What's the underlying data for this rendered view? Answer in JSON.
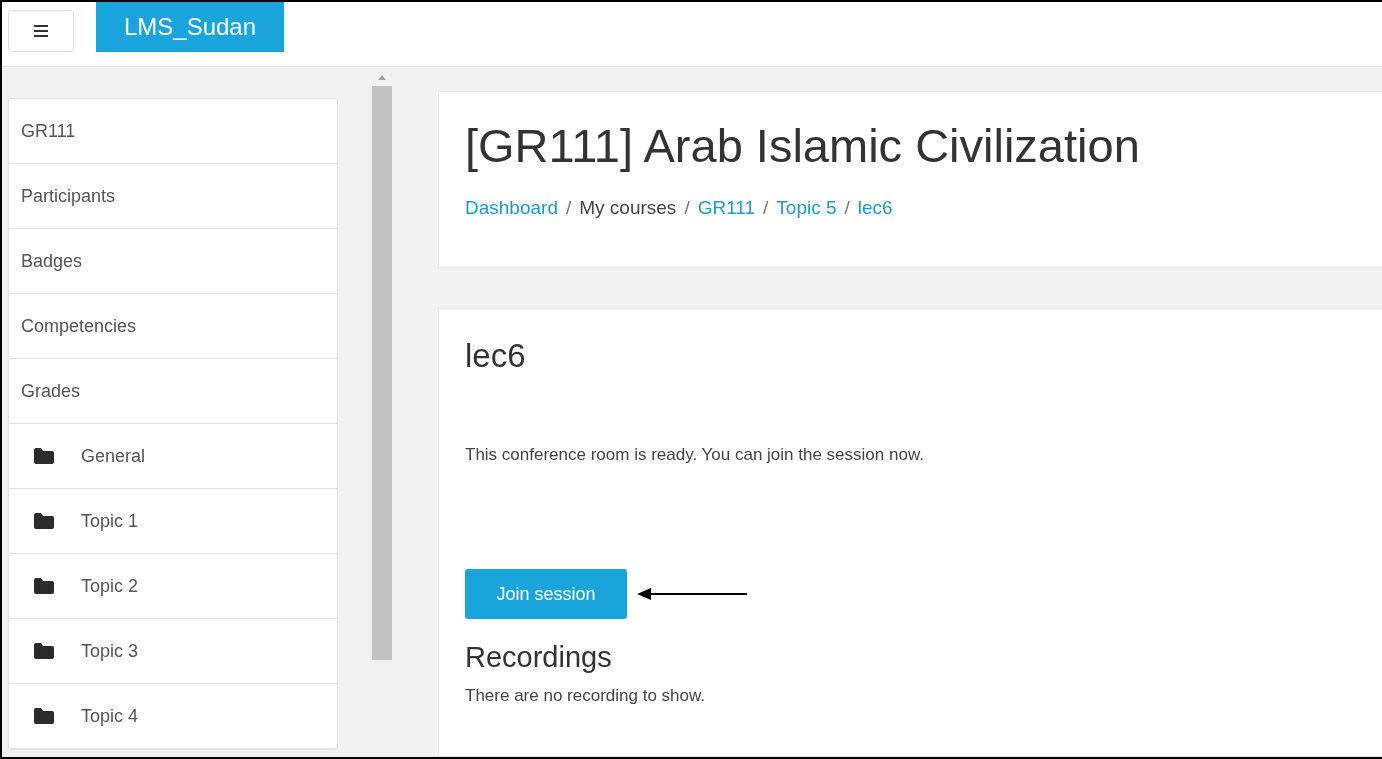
{
  "header": {
    "brand": "LMS_Sudan"
  },
  "sidebar": {
    "items": [
      {
        "label": "GR111",
        "kind": "plain"
      },
      {
        "label": "Participants",
        "kind": "plain"
      },
      {
        "label": "Badges",
        "kind": "plain"
      },
      {
        "label": "Competencies",
        "kind": "plain"
      },
      {
        "label": "Grades",
        "kind": "plain"
      },
      {
        "label": "General",
        "kind": "folder"
      },
      {
        "label": "Topic 1",
        "kind": "folder"
      },
      {
        "label": "Topic 2",
        "kind": "folder"
      },
      {
        "label": "Topic 3",
        "kind": "folder"
      },
      {
        "label": "Topic 4",
        "kind": "folder"
      }
    ]
  },
  "page_header": {
    "title": "[GR111] Arab Islamic Civilization",
    "breadcrumb_separator": "/",
    "breadcrumb": [
      {
        "label": "Dashboard",
        "kind": "link"
      },
      {
        "label": "My courses",
        "kind": "text"
      },
      {
        "label": "GR111",
        "kind": "link"
      },
      {
        "label": "Topic 5",
        "kind": "link"
      },
      {
        "label": "lec6",
        "kind": "link"
      }
    ]
  },
  "content": {
    "title": "lec6",
    "message": "This conference room is ready. You can join the session now.",
    "button": "Join session",
    "recordings_title": "Recordings",
    "recordings_message": "There are no recording to show."
  }
}
